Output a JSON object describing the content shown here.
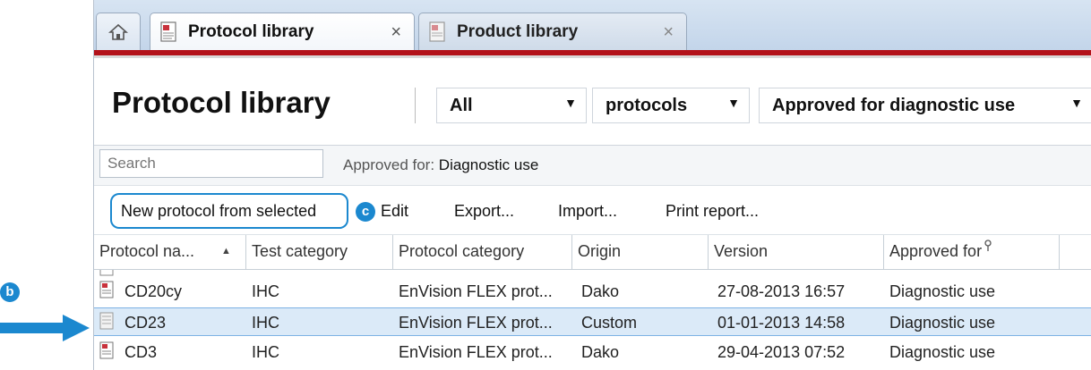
{
  "tabs": [
    {
      "label": "Protocol library",
      "active": true
    },
    {
      "label": "Product library",
      "active": false
    }
  ],
  "icons": {
    "home": "home-icon",
    "close": "close-icon",
    "document": "document-icon",
    "filter": "filter-icon"
  },
  "tab_close_glyph": "×",
  "header": {
    "title": "Protocol library",
    "filter1": "All",
    "filter2": "protocols",
    "filter3": "Approved for diagnostic use"
  },
  "filter_row": {
    "search_placeholder": "Search",
    "approved_label": "Approved for:",
    "approved_value": "Diagnostic use"
  },
  "toolbar": {
    "new_from_selected": "New protocol from selected",
    "edit": "Edit",
    "export": "Export...",
    "import": "Import...",
    "print_report": "Print report..."
  },
  "columns": [
    "Protocol na...",
    "Test category",
    "Protocol category",
    "Origin",
    "Version",
    "Approved for"
  ],
  "rows": [
    {
      "name": "CD20cy",
      "test_category": "IHC",
      "protocol_category": "EnVision FLEX prot...",
      "origin": "Dako",
      "version": "27-08-2013 16:57",
      "approved_for": "Diagnostic use",
      "selected": false
    },
    {
      "name": "CD23",
      "test_category": "IHC",
      "protocol_category": "EnVision FLEX prot...",
      "origin": "Custom",
      "version": "01-01-2013 14:58",
      "approved_for": "Diagnostic use",
      "selected": true
    },
    {
      "name": "CD3",
      "test_category": "IHC",
      "protocol_category": "EnVision FLEX prot...",
      "origin": "Dako",
      "version": "29-04-2013 07:52",
      "approved_for": "Diagnostic use",
      "selected": false
    }
  ],
  "annotations": {
    "b": "b",
    "c": "c"
  },
  "colors": {
    "accent": "#1b88cf",
    "brand_red": "#b3121a",
    "selection": "#dbeaf8"
  }
}
